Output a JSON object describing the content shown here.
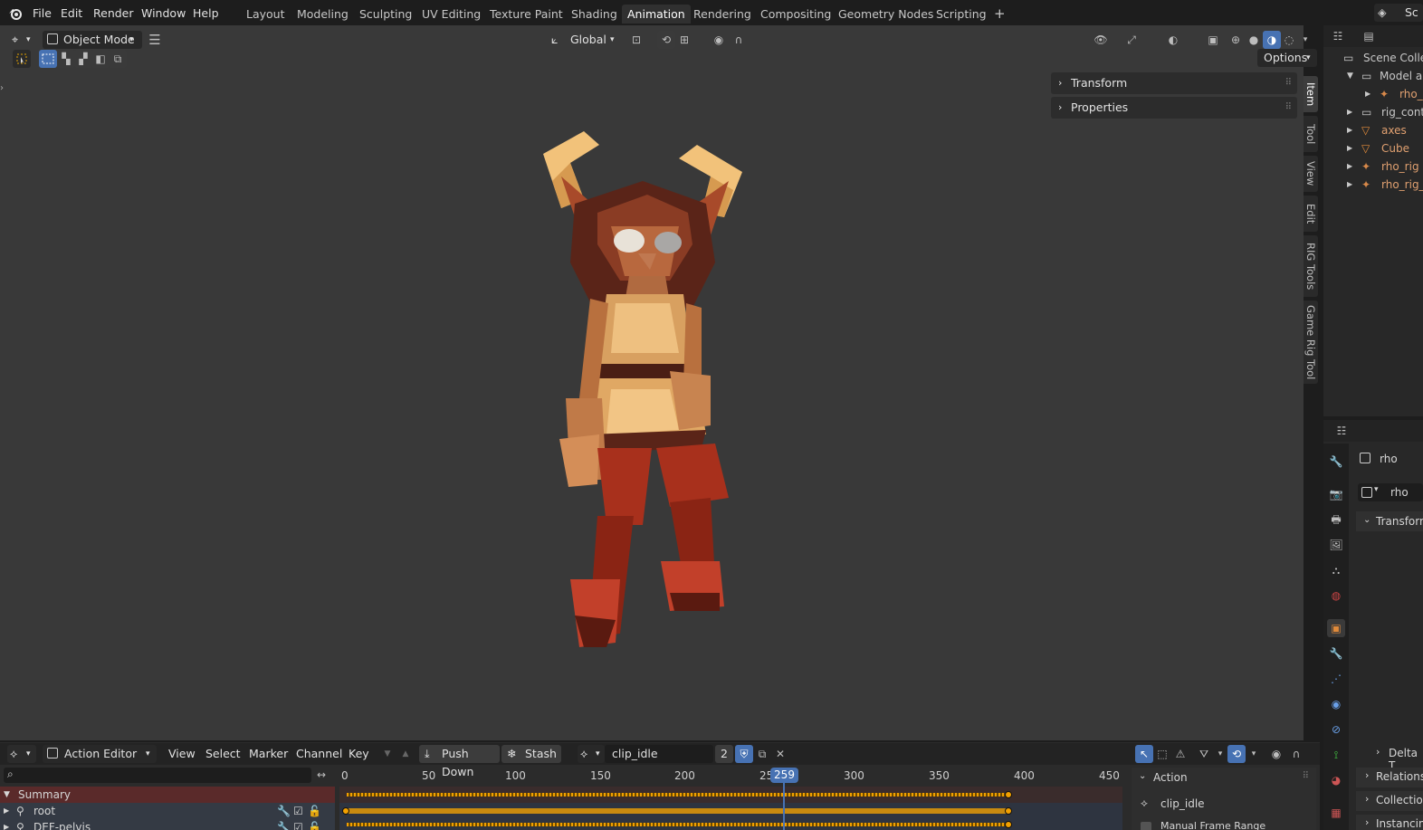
{
  "menu": [
    "File",
    "Edit",
    "Render",
    "Window",
    "Help"
  ],
  "workspaces": {
    "tabs": [
      "Layout",
      "Modeling",
      "Sculpting",
      "UV Editing",
      "Texture Paint",
      "Shading",
      "Animation",
      "Rendering",
      "Compositing",
      "Geometry Nodes",
      "Scripting"
    ],
    "active": "Animation",
    "add_label": "+"
  },
  "scene_label": "Sc",
  "viewport": {
    "mode": "Object Mode",
    "orientation": "Global",
    "options_label": "Options",
    "npanel": {
      "transform_label": "Transform",
      "properties_label": "Properties"
    },
    "sidebar_tabs": [
      "Item",
      "Tool",
      "View",
      "Edit",
      "RIG Tools",
      "Game Rig Tool"
    ],
    "active_sidebar_tab": "Item"
  },
  "outliner": {
    "items": [
      {
        "label": "Scene Colle",
        "icon": "scene-collection-icon"
      },
      {
        "label": "Model a",
        "icon": "collection-icon"
      },
      {
        "label": "rho_",
        "icon": "armature-icon"
      },
      {
        "label": "rig_cont",
        "icon": "collection-icon"
      },
      {
        "label": "axes",
        "icon": "mesh-icon"
      },
      {
        "label": "Cube",
        "icon": "mesh-icon"
      },
      {
        "label": "rho_rig",
        "icon": "armature-icon"
      },
      {
        "label": "rho_rig_",
        "icon": "armature-icon"
      }
    ]
  },
  "properties": {
    "object_name": "rho",
    "data_name": "rho",
    "sections": [
      "Transform",
      "Delta T",
      "Relations",
      "Collection",
      "Instancin"
    ]
  },
  "timeline": {
    "editor_type": "Action Editor",
    "menus": [
      "View",
      "Select",
      "Marker",
      "Channel",
      "Key"
    ],
    "push_down_label": "Push Down",
    "stash_label": "Stash",
    "action_name": "clip_idle",
    "users_count": "2",
    "current_frame": "259",
    "ticks": [
      "0",
      "50",
      "100",
      "150",
      "200",
      "25",
      "300",
      "350",
      "400",
      "450"
    ],
    "channels": [
      {
        "label": "Summary"
      },
      {
        "label": "root"
      },
      {
        "label": "DEF-pelvis"
      }
    ],
    "side_panel": {
      "header": "Action",
      "action_name": "clip_idle",
      "manual_frame_range": "Manual Frame Range"
    }
  },
  "colors": {
    "accent_blue": "#4772b3",
    "keyframe_orange": "#f2a000",
    "summary_red": "#5a2a2a",
    "viewport_bg": "#393939"
  }
}
